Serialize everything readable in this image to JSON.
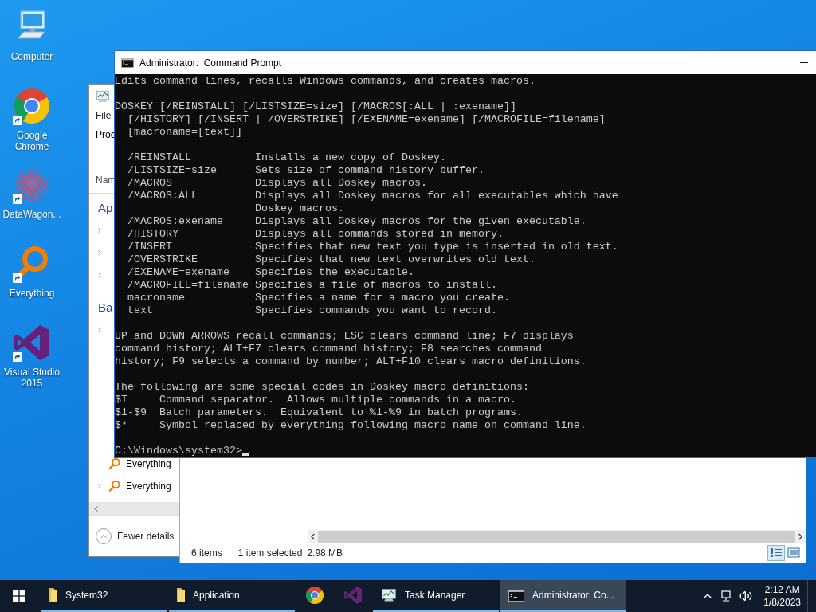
{
  "desktop_icons": [
    {
      "kind": "computer",
      "label": "Computer",
      "shortcut": false
    },
    {
      "kind": "chrome",
      "label": "Google Chrome",
      "shortcut": true
    },
    {
      "kind": "datawagon",
      "label": "DataWagon...",
      "shortcut": true
    },
    {
      "kind": "everything",
      "label": "Everything",
      "shortcut": true
    },
    {
      "kind": "visual-studio",
      "label": "Visual Studio 2015",
      "shortcut": true
    }
  ],
  "task_manager": {
    "menu": "File",
    "tab": "Proc",
    "column_header": "Nam",
    "groups": [
      {
        "title": "Ap",
        "rows": [
          {
            "expandable": true
          },
          {
            "expandable": true
          },
          {
            "expandable": true
          }
        ]
      },
      {
        "title": "Ba",
        "rows": [
          {
            "expandable": true
          },
          {
            "expandable": false
          },
          {
            "expandable": false
          },
          {
            "expandable": false
          },
          {
            "expandable": false
          },
          {
            "expandable": false
          },
          {
            "expandable": false,
            "label": "Everything"
          },
          {
            "expandable": true,
            "label": "Everything"
          }
        ]
      }
    ],
    "footer": "Fewer details"
  },
  "explorer": {
    "status": [
      "6 items",
      "1 item selected",
      "2.98 MB"
    ],
    "view_buttons": [
      {
        "kind": "details",
        "selected": true
      },
      {
        "kind": "large-icons",
        "selected": false
      }
    ]
  },
  "console": {
    "title": "Administrator:  Command Prompt",
    "blocks": [
      [
        "Edits command lines, recalls Windows commands, and creates macros."
      ],
      [
        "DOSKEY [/REINSTALL] [/LISTSIZE=size] [/MACROS[:ALL | :exename]]",
        "  [/HISTORY] [/INSERT | /OVERSTRIKE] [/EXENAME=exename] [/MACROFILE=filename]",
        "  [macroname=[text]]"
      ],
      [
        "  /REINSTALL          Installs a new copy of Doskey.",
        "  /LISTSIZE=size      Sets size of command history buffer.",
        "  /MACROS             Displays all Doskey macros.",
        "  /MACROS:ALL         Displays all Doskey macros for all executables which have",
        "                      Doskey macros.",
        "  /MACROS:exename     Displays all Doskey macros for the given executable.",
        "  /HISTORY            Displays all commands stored in memory.",
        "  /INSERT             Specifies that new text you type is inserted in old text.",
        "  /OVERSTRIKE         Specifies that new text overwrites old text.",
        "  /EXENAME=exename    Specifies the executable.",
        "  /MACROFILE=filename Specifies a file of macros to install.",
        "  macroname           Specifies a name for a macro you create.",
        "  text                Specifies commands you want to record."
      ],
      [
        "UP and DOWN ARROWS recall commands; ESC clears command line; F7 displays",
        "command history; ALT+F7 clears command history; F8 searches command",
        "history; F9 selects a command by number; ALT+F10 clears macro definitions."
      ],
      [
        "The following are some special codes in Doskey macro definitions:",
        "$T     Command separator.  Allows multiple commands in a macro.",
        "$1-$9  Batch parameters.  Equivalent to %1-%9 in batch programs.",
        "$*     Symbol replaced by everything following macro name on command line."
      ]
    ],
    "prompt": "C:\\Windows\\system32>"
  },
  "taskbar": {
    "items": [
      {
        "kind": "folder",
        "label": "System32",
        "running": true,
        "selected": false
      },
      {
        "kind": "folder",
        "label": "Application",
        "running": true,
        "selected": false
      },
      {
        "kind": "chrome",
        "running": false,
        "selected": false
      },
      {
        "kind": "visual-studio",
        "running": false,
        "selected": false
      },
      {
        "kind": "task-manager",
        "label": "Task Manager",
        "running": true,
        "selected": false
      },
      {
        "kind": "console",
        "label": "Administrator: Co...",
        "running": true,
        "selected": true
      }
    ],
    "time": "2:12 AM",
    "date": "1/8/2023"
  }
}
